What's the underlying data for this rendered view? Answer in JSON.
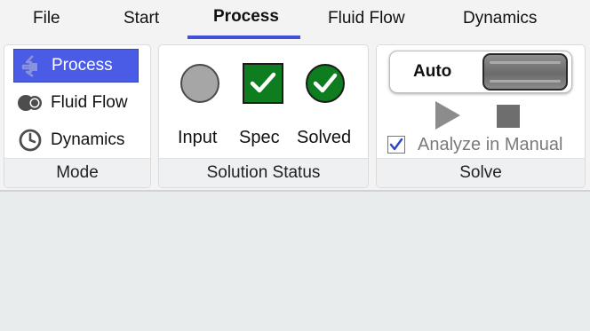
{
  "tabs": [
    {
      "label": "File"
    },
    {
      "label": "Start"
    },
    {
      "label": "Process",
      "active": true
    },
    {
      "label": "Fluid Flow"
    },
    {
      "label": "Dynamics"
    }
  ],
  "mode": {
    "title": "Mode",
    "items": [
      {
        "label": "Process",
        "icon": "process-icon",
        "selected": true
      },
      {
        "label": "Fluid Flow",
        "icon": "fluid-flow-icon"
      },
      {
        "label": "Dynamics",
        "icon": "clock-icon"
      }
    ]
  },
  "solution_status": {
    "title": "Solution Status",
    "items": [
      {
        "label": "Input",
        "icon": "gray-circle-icon"
      },
      {
        "label": "Spec",
        "icon": "green-check-square-icon"
      },
      {
        "label": "Solved",
        "icon": "green-check-circle-icon"
      }
    ]
  },
  "solve": {
    "title": "Solve",
    "toggle_label": "Auto",
    "play_icon": "play-icon",
    "stop_icon": "stop-icon",
    "checkbox_label": "Analyze in Manual",
    "checkbox_checked": true
  },
  "colors": {
    "accent": "#3f51d8",
    "selected": "#4a5ce6",
    "status_green": "#0e7d1f",
    "status_gray": "#a6a6a6"
  }
}
